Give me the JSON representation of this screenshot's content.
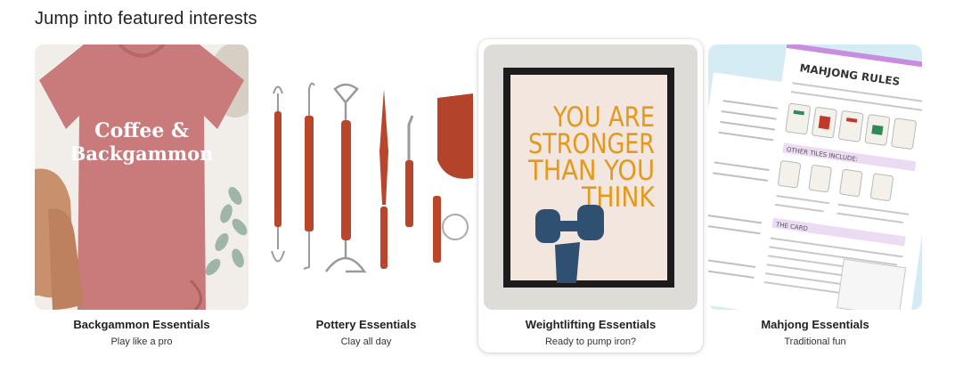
{
  "section": {
    "title": "Jump into featured interests"
  },
  "cards": [
    {
      "title": "Backgammon Essentials",
      "subtitle": "Play like a pro",
      "image_text": [
        "Coffee &",
        "Backgammon"
      ],
      "image_colors": {
        "shirt": "#c97b7c",
        "background": "#efece8",
        "shoes": "#c9906d"
      }
    },
    {
      "title": "Pottery Essentials",
      "subtitle": "Clay all day",
      "image_colors": {
        "wood": "#b9452a",
        "metal": "#9a9a9a"
      }
    },
    {
      "title": "Weightlifting Essentials",
      "subtitle": "Ready to pump iron?",
      "image_text": [
        "YOU ARE",
        "STRONGER",
        "THAN YOU",
        "THINK"
      ],
      "image_colors": {
        "text": "#e39a1c",
        "dumbbell": "#2f5070",
        "frame": "#1c1c1c",
        "wall": "#dcdad6"
      }
    },
    {
      "title": "Mahjong Essentials",
      "subtitle": "Traditional fun",
      "image_text": [
        "MAHJONG RULES",
        "OTHER TILES INCLUDE:",
        "THE CARD"
      ],
      "image_colors": {
        "background": "#d6ecf5",
        "accent": "#c88de0"
      }
    }
  ],
  "active_card": "Weightlifting Essentials"
}
